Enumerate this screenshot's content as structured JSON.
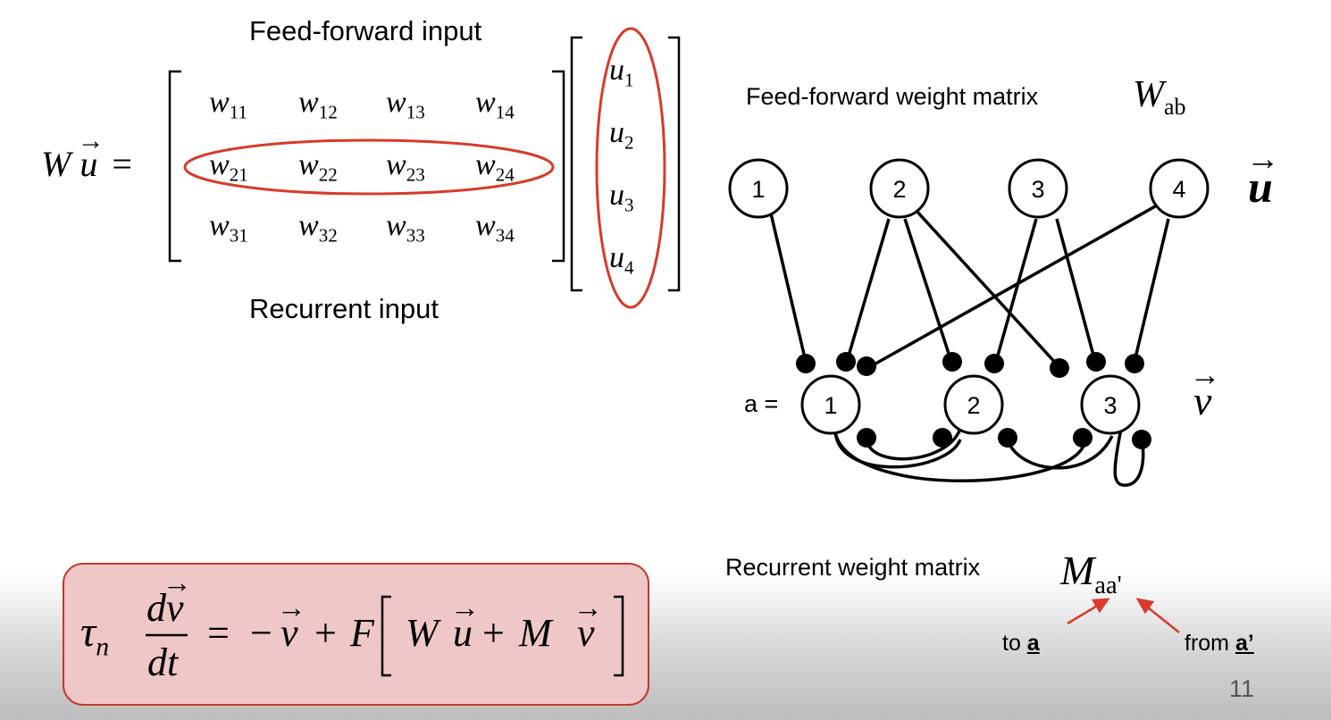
{
  "matrix": {
    "lhs_w": "W",
    "lhs_u": "u",
    "equals": "=",
    "feedforward_label": "Feed-forward input",
    "recurrent_label": "Recurrent input",
    "w_letter": "w",
    "rows": [
      [
        "11",
        "12",
        "13",
        "14"
      ],
      [
        "21",
        "22",
        "23",
        "24"
      ],
      [
        "31",
        "32",
        "33",
        "34"
      ]
    ],
    "u_letter": "u",
    "u_subs": [
      "1",
      "2",
      "3",
      "4"
    ]
  },
  "network": {
    "title_text": "Feed-forward weight matrix",
    "title_symbol": "W",
    "title_sub": "ab",
    "input_nodes": [
      "1",
      "2",
      "3",
      "4"
    ],
    "input_vector_label": "u",
    "output_prefix": "a =",
    "output_nodes": [
      "1",
      "2",
      "3"
    ],
    "output_vector_label": "v",
    "recurrent_title": "Recurrent weight matrix",
    "recurrent_symbol": "M",
    "recurrent_sub": "aa'",
    "to_text": "to ",
    "to_var": "a",
    "from_text": "from ",
    "from_var": "a’"
  },
  "equation": {
    "tau": "τ",
    "tau_sub": "n",
    "num_d": "d",
    "num_v": "v",
    "den": "dt",
    "rhs_eq": "=",
    "minus": "−",
    "v1": "v",
    "plus1": "+",
    "F": "F",
    "lbr": "[",
    "W": "W",
    "u": "u",
    "plus2": "+",
    "M": "M",
    "v2": "v",
    "rbr": "]"
  },
  "page_number": "11",
  "colors": {
    "accent_red": "#d93a2b",
    "equation_box_fill": "#efc7c7",
    "equation_box_border": "#c0392b"
  }
}
